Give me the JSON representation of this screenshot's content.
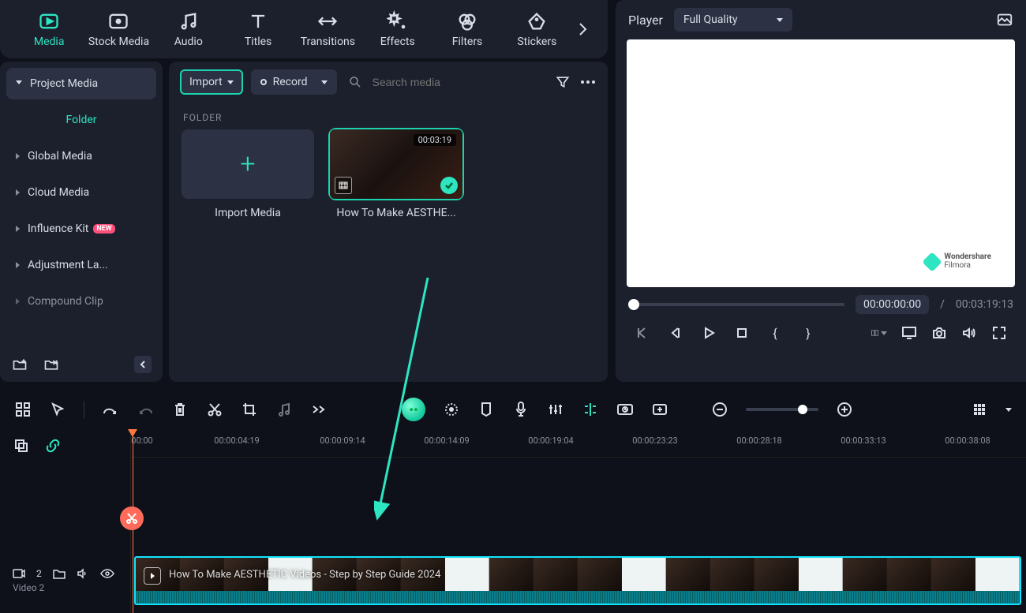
{
  "tabs": {
    "media": "Media",
    "stock_media": "Stock Media",
    "audio": "Audio",
    "titles": "Titles",
    "transitions": "Transitions",
    "effects": "Effects",
    "filters": "Filters",
    "stickers": "Stickers"
  },
  "sidebar": {
    "project_media": "Project Media",
    "folder": "Folder",
    "global_media": "Global Media",
    "cloud_media": "Cloud Media",
    "influence_kit": "Influence Kit",
    "influence_kit_badge": "NEW",
    "adjustment_layer": "Adjustment La...",
    "compound_clip": "Compound Clip"
  },
  "media_panel": {
    "import": "Import",
    "record": "Record",
    "search_placeholder": "Search media",
    "section_label": "FOLDER",
    "import_media": "Import Media",
    "clip1_name": "How To Make AESTHE...",
    "clip1_duration": "00:03:19"
  },
  "player": {
    "label": "Player",
    "quality": "Full Quality",
    "watermark_brand": "Wondershare",
    "watermark_product": "Filmora",
    "time_current": "00:00:00:00",
    "time_sep": "/",
    "time_total": "00:03:19:13"
  },
  "timeline": {
    "ruler": [
      "00:00",
      "00:00:04:19",
      "00:00:09:14",
      "00:00:14:09",
      "00:00:19:04",
      "00:00:23:23",
      "00:00:28:18",
      "00:00:33:13",
      "00:00:38:08"
    ],
    "track_count": "2",
    "track_name": "Video 2",
    "clip_label": "How To Make AESTHETIC Videos - Step by Step Guide 2024"
  }
}
